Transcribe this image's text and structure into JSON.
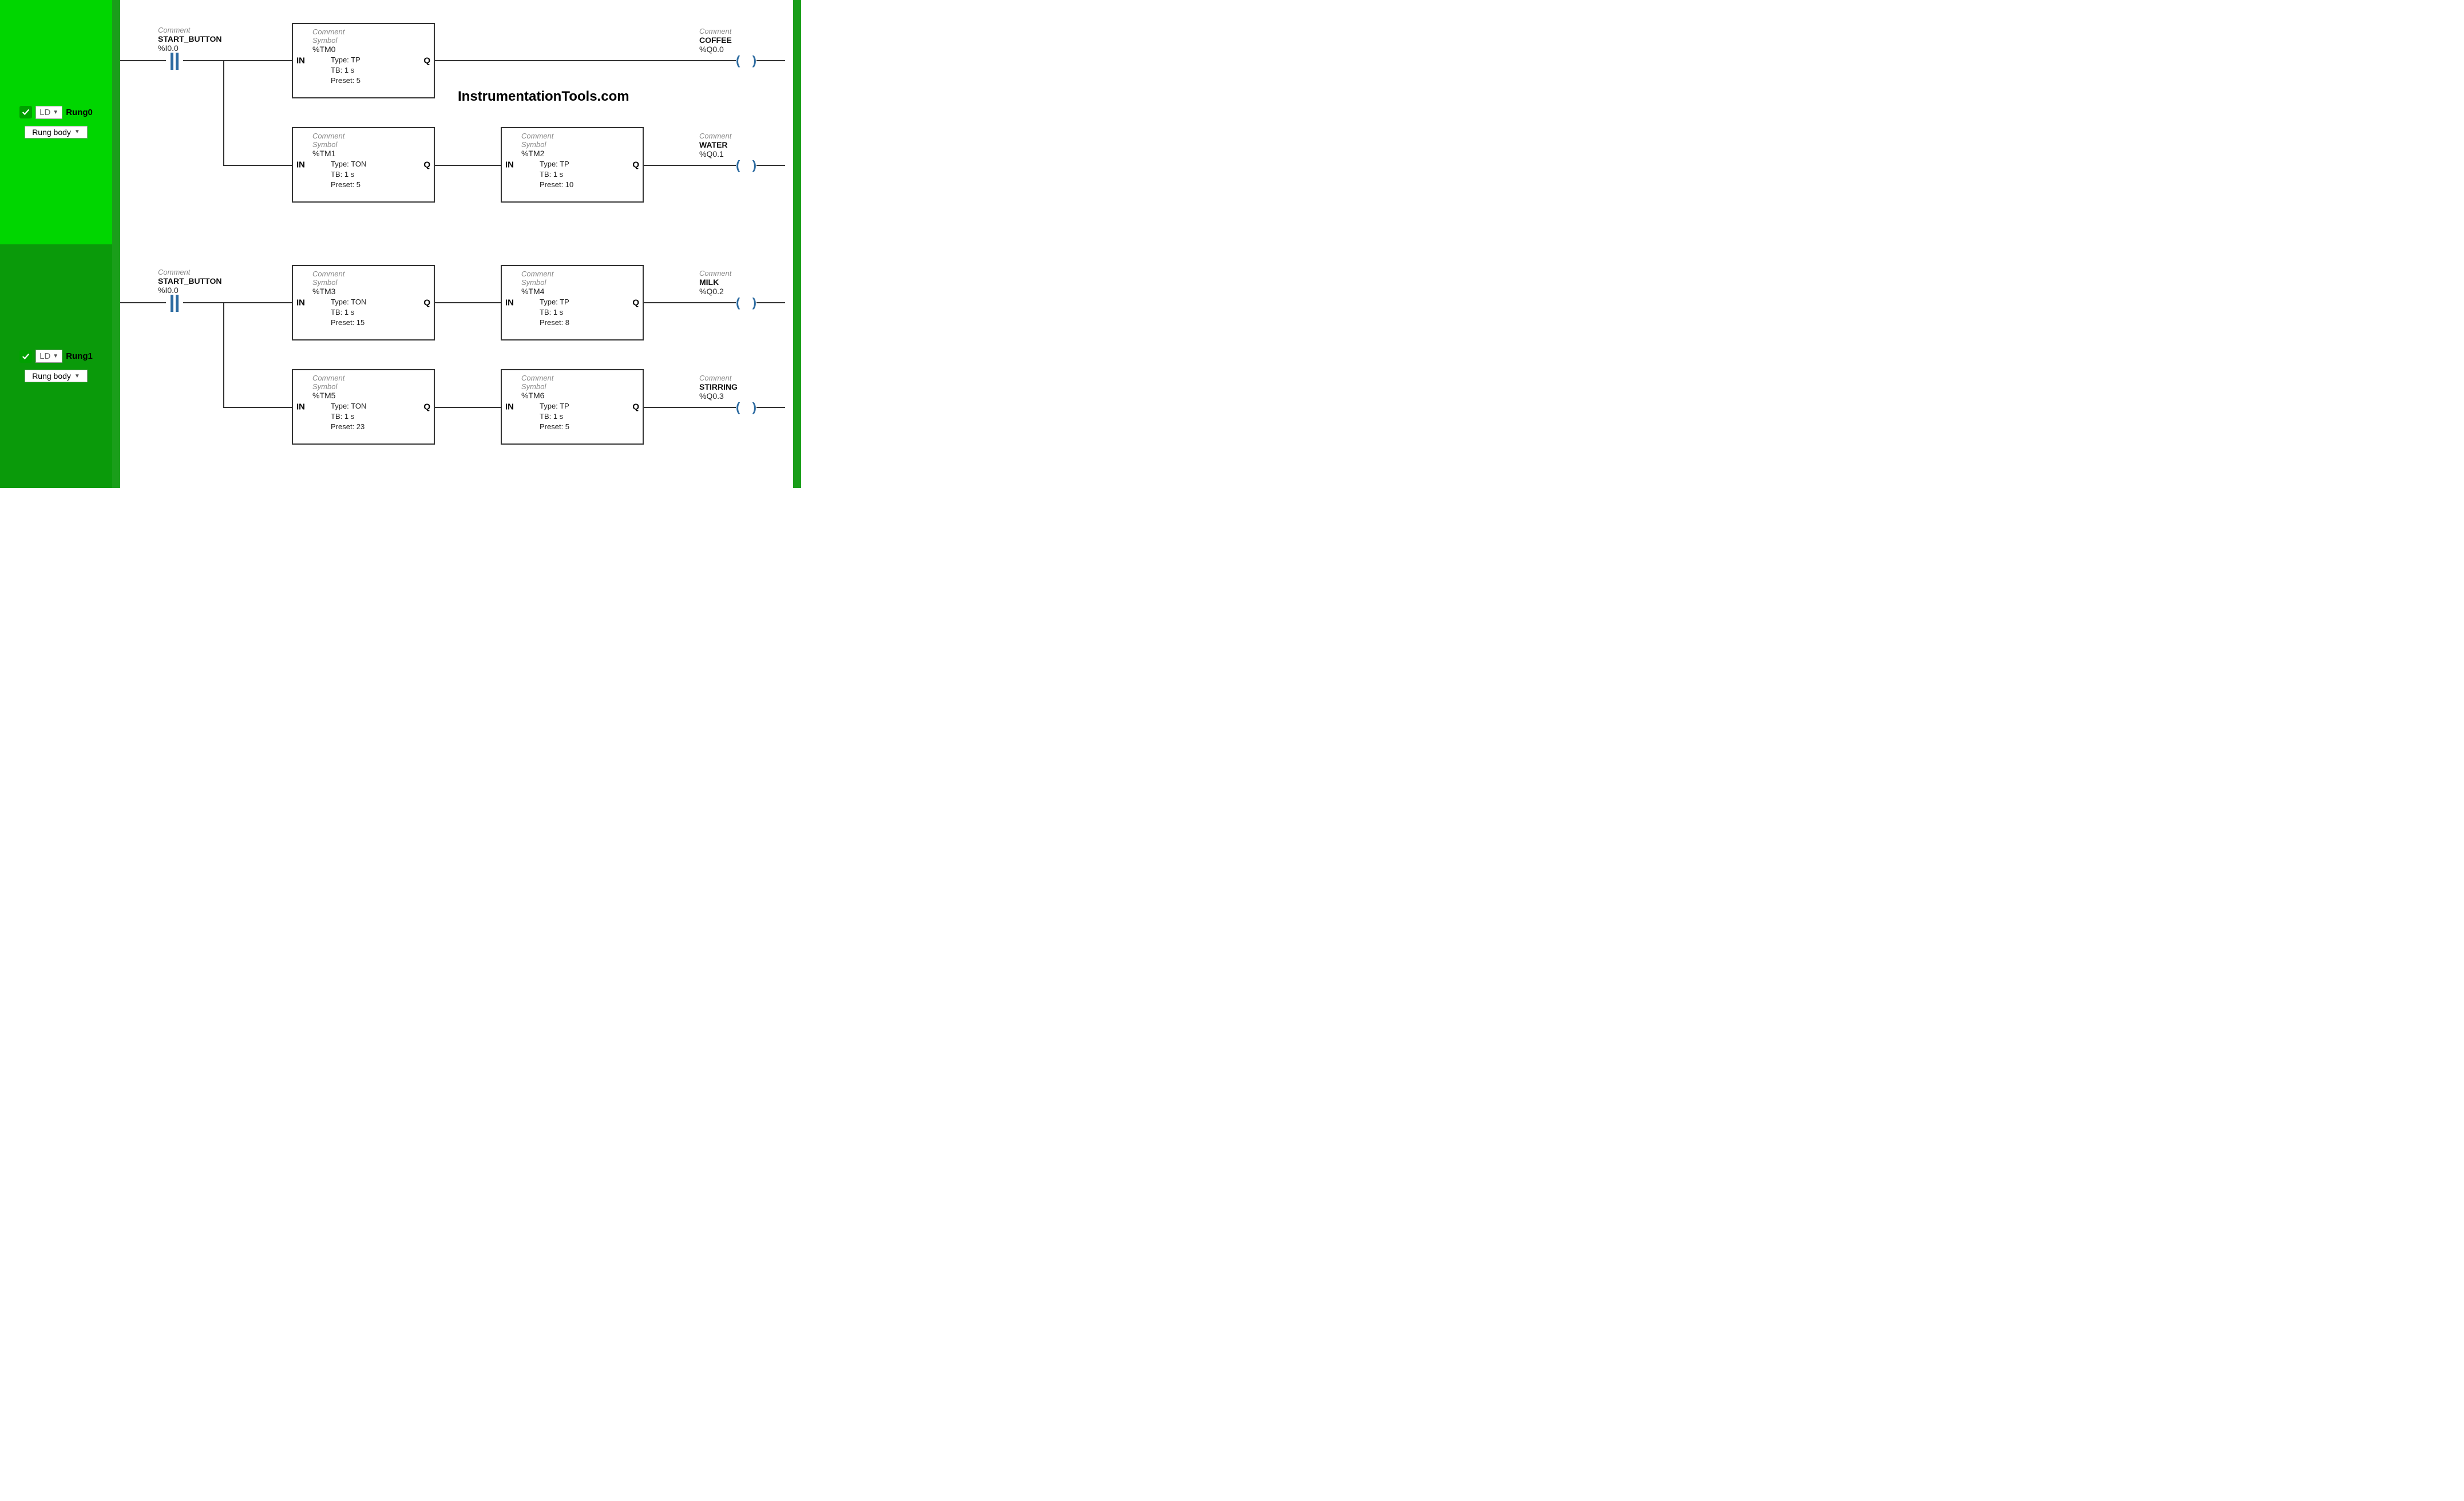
{
  "labels": {
    "comment": "Comment",
    "symbol": "Symbol",
    "in": "IN",
    "q": "Q",
    "type_prefix": "Type: ",
    "tb_prefix": "TB: ",
    "preset_prefix": "Preset: ",
    "ld": "LD",
    "rung_body": "Rung body"
  },
  "watermark": "InstrumentationTools.com",
  "rungs": [
    {
      "name": "Rung0",
      "contact": {
        "symbol": "START_BUTTON",
        "address": "%I0.0"
      },
      "branches": [
        {
          "timers": [
            {
              "address": "%TM0",
              "type": "TP",
              "tb": "1 s",
              "preset": "5"
            }
          ],
          "coil": {
            "symbol": "COFFEE",
            "address": "%Q0.0"
          }
        },
        {
          "timers": [
            {
              "address": "%TM1",
              "type": "TON",
              "tb": "1 s",
              "preset": "5"
            },
            {
              "address": "%TM2",
              "type": "TP",
              "tb": "1 s",
              "preset": "10"
            }
          ],
          "coil": {
            "symbol": "WATER",
            "address": "%Q0.1"
          }
        }
      ]
    },
    {
      "name": "Rung1",
      "contact": {
        "symbol": "START_BUTTON",
        "address": "%I0.0"
      },
      "branches": [
        {
          "timers": [
            {
              "address": "%TM3",
              "type": "TON",
              "tb": "1 s",
              "preset": "15"
            },
            {
              "address": "%TM4",
              "type": "TP",
              "tb": "1 s",
              "preset": "8"
            }
          ],
          "coil": {
            "symbol": "MILK",
            "address": "%Q0.2"
          }
        },
        {
          "timers": [
            {
              "address": "%TM5",
              "type": "TON",
              "tb": "1 s",
              "preset": "23"
            },
            {
              "address": "%TM6",
              "type": "TP",
              "tb": "1 s",
              "preset": "5"
            }
          ],
          "coil": {
            "symbol": "STIRRING",
            "address": "%Q0.3"
          }
        }
      ]
    }
  ]
}
